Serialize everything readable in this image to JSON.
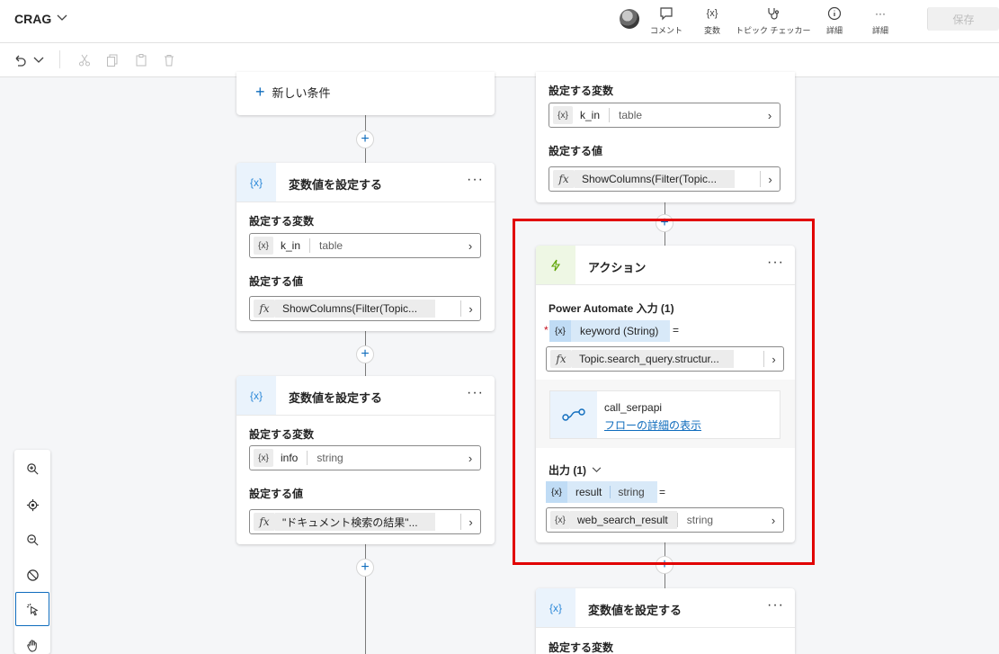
{
  "header": {
    "title": "CRAG",
    "buttons": {
      "comment": "コメント",
      "variables": "変数",
      "topic_checker": "トピック チェッカー",
      "details": "詳細",
      "more": "詳細"
    },
    "save": "保存"
  },
  "canvas": {
    "new_condition": "新しい条件",
    "left_card1": {
      "title": "変数値を設定する",
      "var_label": "設定する変数",
      "var_name": "k_in",
      "var_type": "table",
      "val_label": "設定する値",
      "value": "ShowColumns(Filter(Topic..."
    },
    "left_card2": {
      "title": "変数値を設定する",
      "var_label": "設定する変数",
      "var_name": "info",
      "var_type": "string",
      "val_label": "設定する値",
      "value": "\"ドキュメント検索の結果\"..."
    },
    "right_top": {
      "var_label": "設定する変数",
      "var_name": "k_in",
      "var_type": "table",
      "val_label": "設定する値",
      "value": "ShowColumns(Filter(Topic..."
    },
    "action_card": {
      "title": "アクション",
      "input_label": "Power Automate 入力 (1)",
      "input_param": "keyword (String)",
      "equals": "=",
      "required_mark": "*",
      "input_value": "Topic.search_query.structur...",
      "flow_name": "call_serpapi",
      "flow_link": "フローの詳細の表示",
      "output_label": "出力 (1)",
      "output_var": "result",
      "output_type": "string",
      "output_value_var": "web_search_result",
      "output_value_type": "string"
    },
    "right_bottom": {
      "title": "変数値を設定する",
      "var_label": "設定する変数"
    }
  },
  "icons": {
    "variable": "{x}",
    "formula": "fx",
    "more": "···"
  }
}
